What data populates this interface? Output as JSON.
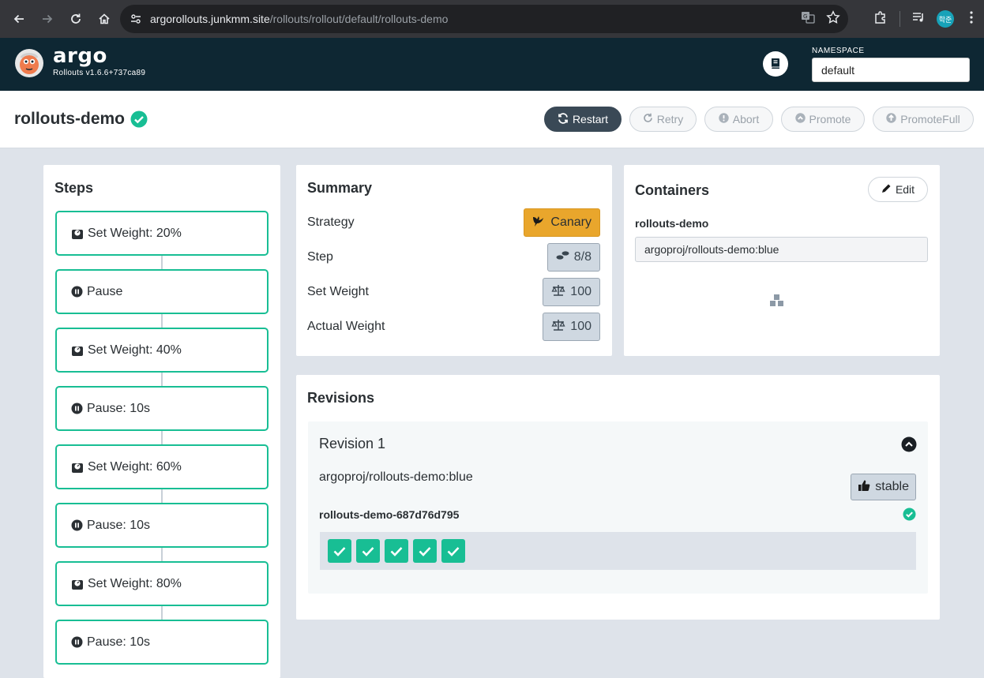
{
  "browser": {
    "url_host": "argorollouts.junkmm.site",
    "url_path": "/rollouts/rollout/default/rollouts-demo",
    "profile_initials": "학준"
  },
  "header": {
    "brand": "argo",
    "version": "Rollouts v1.6.6+737ca89",
    "namespace_label": "NAMESPACE",
    "namespace_value": "default"
  },
  "page": {
    "title": "rollouts-demo",
    "status": "healthy",
    "actions": {
      "restart": "Restart",
      "retry": "Retry",
      "abort": "Abort",
      "promote": "Promote",
      "promote_full": "PromoteFull"
    }
  },
  "steps": {
    "title": "Steps",
    "items": [
      {
        "label": "Set Weight: 20%",
        "icon": "weight-icon"
      },
      {
        "label": "Pause",
        "icon": "pause-icon"
      },
      {
        "label": "Set Weight: 40%",
        "icon": "weight-icon"
      },
      {
        "label": "Pause: 10s",
        "icon": "pause-icon"
      },
      {
        "label": "Set Weight: 60%",
        "icon": "weight-icon"
      },
      {
        "label": "Pause: 10s",
        "icon": "pause-icon"
      },
      {
        "label": "Set Weight: 80%",
        "icon": "weight-icon"
      },
      {
        "label": "Pause: 10s",
        "icon": "pause-icon"
      }
    ]
  },
  "summary": {
    "title": "Summary",
    "strategy_label": "Strategy",
    "strategy_value": "Canary",
    "step_label": "Step",
    "step_value": "8/8",
    "set_weight_label": "Set Weight",
    "set_weight_value": "100",
    "actual_weight_label": "Actual Weight",
    "actual_weight_value": "100"
  },
  "containers": {
    "title": "Containers",
    "edit_label": "Edit",
    "name": "rollouts-demo",
    "image": "argoproj/rollouts-demo:blue"
  },
  "revisions": {
    "title": "Revisions",
    "items": [
      {
        "title": "Revision 1",
        "image": "argoproj/rollouts-demo:blue",
        "badge": "stable",
        "replicaset": "rollouts-demo-687d76d795",
        "pods_ready": 5
      }
    ]
  },
  "colors": {
    "header_bg": "#0e2733",
    "success": "#18be94",
    "canary": "#e9a62c"
  }
}
